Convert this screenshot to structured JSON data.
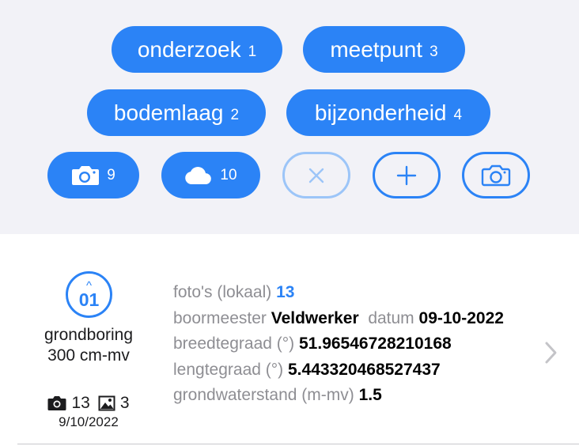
{
  "category_pills": [
    {
      "label": "onderzoek",
      "count": "1"
    },
    {
      "label": "meetpunt",
      "count": "3"
    },
    {
      "label": "bodemlaag",
      "count": "2"
    },
    {
      "label": "bijzonderheid",
      "count": "4"
    }
  ],
  "actions": {
    "photos_count": "9",
    "cloud_count": "10"
  },
  "icons": {
    "photos": "camera-icon",
    "cloud": "cloud-icon",
    "clear": "close-icon",
    "add": "plus-icon",
    "capture": "camera-outline-icon",
    "step_chevron": "chevron-up-icon",
    "detail_chevron": "chevron-right-icon",
    "meta_camera": "camera-icon",
    "meta_image": "image-icon"
  },
  "colors": {
    "accent": "#2b83f6",
    "accent_faded": "#9cc5f8",
    "panel_background": "#f2f2f7",
    "secondary_text": "#8e8e93"
  },
  "record": {
    "step_chevron": "^",
    "step_number": "01",
    "type": "grondboring",
    "depth": "300 cm-mv",
    "photo_count": "13",
    "image_count": "3",
    "date_short": "9/10/2022",
    "photos_local_label": "foto's (lokaal)",
    "photos_local_value": "13",
    "boormeester_label": "boormeester",
    "boormeester_value": "Veldwerker",
    "datum_label": "datum",
    "datum_value": "09-10-2022",
    "breedtegraad_label": "breedtegraad (°)",
    "breedtegraad_value": "51.96546728210168",
    "lengtegraad_label": "lengtegraad (°)",
    "lengtegraad_value": "5.443320468527437",
    "grondwater_label": "grondwaterstand (m-mv)",
    "grondwater_value": "1.5"
  }
}
